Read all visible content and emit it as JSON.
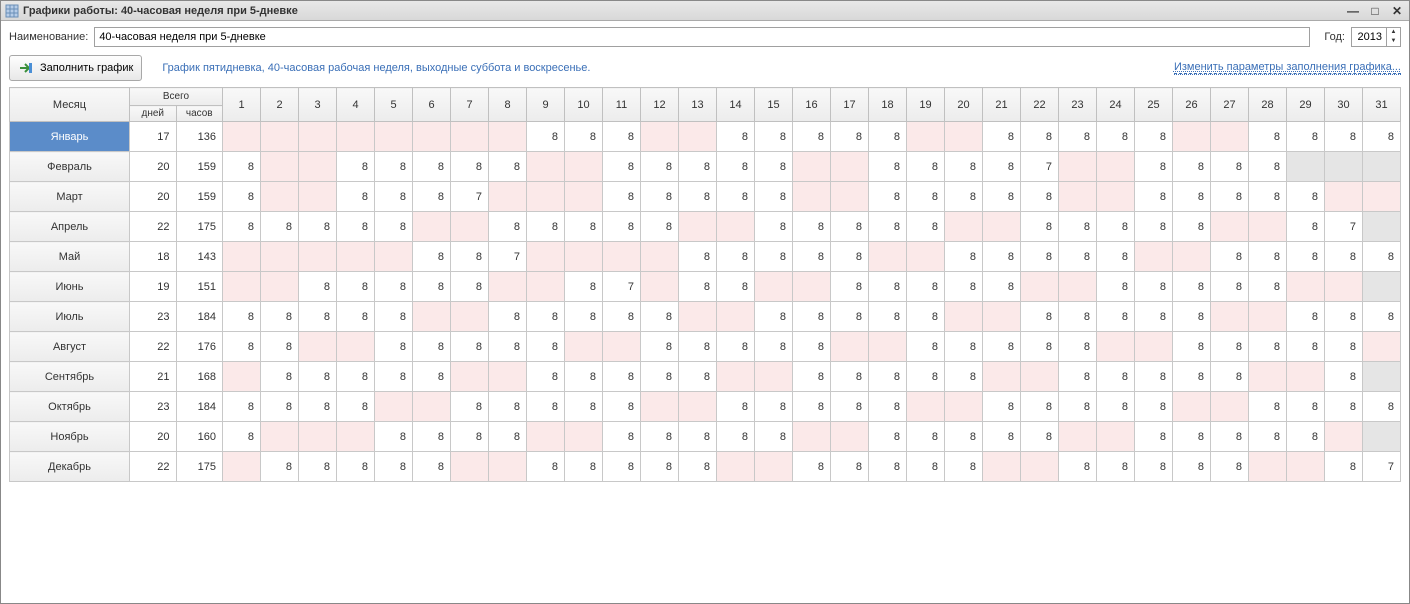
{
  "window": {
    "title": "Графики работы: 40-часовая неделя при 5-дневке"
  },
  "labels": {
    "name": "Наименование:",
    "year": "Год:",
    "fill": "Заполнить график",
    "desc": "График пятидневка, 40-часовая рабочая неделя, выходные суббота и воскресенье.",
    "change_params": "Изменить параметры заполнения графика...",
    "month": "Месяц",
    "total": "Всего",
    "days_sub": "дней",
    "hours_sub": "часов"
  },
  "values": {
    "name": "40-часовая неделя при 5-дневке",
    "year": "2013"
  },
  "day_headers": [
    "1",
    "2",
    "3",
    "4",
    "5",
    "6",
    "7",
    "8",
    "9",
    "10",
    "11",
    "12",
    "13",
    "14",
    "15",
    "16",
    "17",
    "18",
    "19",
    "20",
    "21",
    "22",
    "23",
    "24",
    "25",
    "26",
    "27",
    "28",
    "29",
    "30",
    "31"
  ],
  "months": [
    {
      "name": "Январь",
      "days": 17,
      "hours": 136,
      "selected": true,
      "cells": [
        {
          "t": "off"
        },
        {
          "t": "off"
        },
        {
          "t": "off"
        },
        {
          "t": "off"
        },
        {
          "t": "off"
        },
        {
          "t": "off"
        },
        {
          "t": "off"
        },
        {
          "t": "off"
        },
        {
          "v": 8
        },
        {
          "v": 8
        },
        {
          "v": 8
        },
        {
          "t": "off"
        },
        {
          "t": "off"
        },
        {
          "v": 8
        },
        {
          "v": 8
        },
        {
          "v": 8
        },
        {
          "v": 8
        },
        {
          "v": 8
        },
        {
          "t": "off"
        },
        {
          "t": "off"
        },
        {
          "v": 8
        },
        {
          "v": 8
        },
        {
          "v": 8
        },
        {
          "v": 8
        },
        {
          "v": 8
        },
        {
          "t": "off"
        },
        {
          "t": "off"
        },
        {
          "v": 8
        },
        {
          "v": 8
        },
        {
          "v": 8
        },
        {
          "v": 8
        }
      ]
    },
    {
      "name": "Февраль",
      "days": 20,
      "hours": 159,
      "cells": [
        {
          "v": 8
        },
        {
          "t": "off"
        },
        {
          "t": "off"
        },
        {
          "v": 8
        },
        {
          "v": 8
        },
        {
          "v": 8
        },
        {
          "v": 8
        },
        {
          "v": 8
        },
        {
          "t": "off"
        },
        {
          "t": "off"
        },
        {
          "v": 8
        },
        {
          "v": 8
        },
        {
          "v": 8
        },
        {
          "v": 8
        },
        {
          "v": 8
        },
        {
          "t": "off"
        },
        {
          "t": "off"
        },
        {
          "v": 8
        },
        {
          "v": 8
        },
        {
          "v": 8
        },
        {
          "v": 8
        },
        {
          "v": 7
        },
        {
          "t": "off"
        },
        {
          "t": "off"
        },
        {
          "v": 8
        },
        {
          "v": 8
        },
        {
          "v": 8
        },
        {
          "v": 8
        },
        {
          "t": "na"
        },
        {
          "t": "na"
        },
        {
          "t": "na"
        }
      ]
    },
    {
      "name": "Март",
      "days": 20,
      "hours": 159,
      "cells": [
        {
          "v": 8
        },
        {
          "t": "off"
        },
        {
          "t": "off"
        },
        {
          "v": 8
        },
        {
          "v": 8
        },
        {
          "v": 8
        },
        {
          "v": 7
        },
        {
          "t": "off"
        },
        {
          "t": "off"
        },
        {
          "t": "off"
        },
        {
          "v": 8
        },
        {
          "v": 8
        },
        {
          "v": 8
        },
        {
          "v": 8
        },
        {
          "v": 8
        },
        {
          "t": "off"
        },
        {
          "t": "off"
        },
        {
          "v": 8
        },
        {
          "v": 8
        },
        {
          "v": 8
        },
        {
          "v": 8
        },
        {
          "v": 8
        },
        {
          "t": "off"
        },
        {
          "t": "off"
        },
        {
          "v": 8
        },
        {
          "v": 8
        },
        {
          "v": 8
        },
        {
          "v": 8
        },
        {
          "v": 8
        },
        {
          "t": "off"
        },
        {
          "t": "off"
        }
      ]
    },
    {
      "name": "Апрель",
      "days": 22,
      "hours": 175,
      "cells": [
        {
          "v": 8
        },
        {
          "v": 8
        },
        {
          "v": 8
        },
        {
          "v": 8
        },
        {
          "v": 8
        },
        {
          "t": "off"
        },
        {
          "t": "off"
        },
        {
          "v": 8
        },
        {
          "v": 8
        },
        {
          "v": 8
        },
        {
          "v": 8
        },
        {
          "v": 8
        },
        {
          "t": "off"
        },
        {
          "t": "off"
        },
        {
          "v": 8
        },
        {
          "v": 8
        },
        {
          "v": 8
        },
        {
          "v": 8
        },
        {
          "v": 8
        },
        {
          "t": "off"
        },
        {
          "t": "off"
        },
        {
          "v": 8
        },
        {
          "v": 8
        },
        {
          "v": 8
        },
        {
          "v": 8
        },
        {
          "v": 8
        },
        {
          "t": "off"
        },
        {
          "t": "off"
        },
        {
          "v": 8
        },
        {
          "v": 7
        },
        {
          "t": "na"
        }
      ]
    },
    {
      "name": "Май",
      "days": 18,
      "hours": 143,
      "cells": [
        {
          "t": "off"
        },
        {
          "t": "off"
        },
        {
          "t": "off"
        },
        {
          "t": "off"
        },
        {
          "t": "off"
        },
        {
          "v": 8
        },
        {
          "v": 8
        },
        {
          "v": 7
        },
        {
          "t": "off"
        },
        {
          "t": "off"
        },
        {
          "t": "off"
        },
        {
          "t": "off"
        },
        {
          "v": 8
        },
        {
          "v": 8
        },
        {
          "v": 8
        },
        {
          "v": 8
        },
        {
          "v": 8
        },
        {
          "t": "off"
        },
        {
          "t": "off"
        },
        {
          "v": 8
        },
        {
          "v": 8
        },
        {
          "v": 8
        },
        {
          "v": 8
        },
        {
          "v": 8
        },
        {
          "t": "off"
        },
        {
          "t": "off"
        },
        {
          "v": 8
        },
        {
          "v": 8
        },
        {
          "v": 8
        },
        {
          "v": 8
        },
        {
          "v": 8
        }
      ]
    },
    {
      "name": "Июнь",
      "days": 19,
      "hours": 151,
      "cells": [
        {
          "t": "off"
        },
        {
          "t": "off"
        },
        {
          "v": 8
        },
        {
          "v": 8
        },
        {
          "v": 8
        },
        {
          "v": 8
        },
        {
          "v": 8
        },
        {
          "t": "off"
        },
        {
          "t": "off"
        },
        {
          "v": 8
        },
        {
          "v": 7
        },
        {
          "t": "off"
        },
        {
          "v": 8
        },
        {
          "v": 8
        },
        {
          "t": "off"
        },
        {
          "t": "off"
        },
        {
          "v": 8
        },
        {
          "v": 8
        },
        {
          "v": 8
        },
        {
          "v": 8
        },
        {
          "v": 8
        },
        {
          "t": "off"
        },
        {
          "t": "off"
        },
        {
          "v": 8
        },
        {
          "v": 8
        },
        {
          "v": 8
        },
        {
          "v": 8
        },
        {
          "v": 8
        },
        {
          "t": "off"
        },
        {
          "t": "off"
        },
        {
          "t": "na"
        }
      ]
    },
    {
      "name": "Июль",
      "days": 23,
      "hours": 184,
      "cells": [
        {
          "v": 8
        },
        {
          "v": 8
        },
        {
          "v": 8
        },
        {
          "v": 8
        },
        {
          "v": 8
        },
        {
          "t": "off"
        },
        {
          "t": "off"
        },
        {
          "v": 8
        },
        {
          "v": 8
        },
        {
          "v": 8
        },
        {
          "v": 8
        },
        {
          "v": 8
        },
        {
          "t": "off"
        },
        {
          "t": "off"
        },
        {
          "v": 8
        },
        {
          "v": 8
        },
        {
          "v": 8
        },
        {
          "v": 8
        },
        {
          "v": 8
        },
        {
          "t": "off"
        },
        {
          "t": "off"
        },
        {
          "v": 8
        },
        {
          "v": 8
        },
        {
          "v": 8
        },
        {
          "v": 8
        },
        {
          "v": 8
        },
        {
          "t": "off"
        },
        {
          "t": "off"
        },
        {
          "v": 8
        },
        {
          "v": 8
        },
        {
          "v": 8
        }
      ]
    },
    {
      "name": "Август",
      "days": 22,
      "hours": 176,
      "cells": [
        {
          "v": 8
        },
        {
          "v": 8
        },
        {
          "t": "off"
        },
        {
          "t": "off"
        },
        {
          "v": 8
        },
        {
          "v": 8
        },
        {
          "v": 8
        },
        {
          "v": 8
        },
        {
          "v": 8
        },
        {
          "t": "off"
        },
        {
          "t": "off"
        },
        {
          "v": 8
        },
        {
          "v": 8
        },
        {
          "v": 8
        },
        {
          "v": 8
        },
        {
          "v": 8
        },
        {
          "t": "off"
        },
        {
          "t": "off"
        },
        {
          "v": 8
        },
        {
          "v": 8
        },
        {
          "v": 8
        },
        {
          "v": 8
        },
        {
          "v": 8
        },
        {
          "t": "off"
        },
        {
          "t": "off"
        },
        {
          "v": 8
        },
        {
          "v": 8
        },
        {
          "v": 8
        },
        {
          "v": 8
        },
        {
          "v": 8
        },
        {
          "t": "off"
        }
      ]
    },
    {
      "name": "Сентябрь",
      "days": 21,
      "hours": 168,
      "cells": [
        {
          "t": "off"
        },
        {
          "v": 8
        },
        {
          "v": 8
        },
        {
          "v": 8
        },
        {
          "v": 8
        },
        {
          "v": 8
        },
        {
          "t": "off"
        },
        {
          "t": "off"
        },
        {
          "v": 8
        },
        {
          "v": 8
        },
        {
          "v": 8
        },
        {
          "v": 8
        },
        {
          "v": 8
        },
        {
          "t": "off"
        },
        {
          "t": "off"
        },
        {
          "v": 8
        },
        {
          "v": 8
        },
        {
          "v": 8
        },
        {
          "v": 8
        },
        {
          "v": 8
        },
        {
          "t": "off"
        },
        {
          "t": "off"
        },
        {
          "v": 8
        },
        {
          "v": 8
        },
        {
          "v": 8
        },
        {
          "v": 8
        },
        {
          "v": 8
        },
        {
          "t": "off"
        },
        {
          "t": "off"
        },
        {
          "v": 8
        },
        {
          "t": "na"
        }
      ]
    },
    {
      "name": "Октябрь",
      "days": 23,
      "hours": 184,
      "cells": [
        {
          "v": 8
        },
        {
          "v": 8
        },
        {
          "v": 8
        },
        {
          "v": 8
        },
        {
          "t": "off"
        },
        {
          "t": "off"
        },
        {
          "v": 8
        },
        {
          "v": 8
        },
        {
          "v": 8
        },
        {
          "v": 8
        },
        {
          "v": 8
        },
        {
          "t": "off"
        },
        {
          "t": "off"
        },
        {
          "v": 8
        },
        {
          "v": 8
        },
        {
          "v": 8
        },
        {
          "v": 8
        },
        {
          "v": 8
        },
        {
          "t": "off"
        },
        {
          "t": "off"
        },
        {
          "v": 8
        },
        {
          "v": 8
        },
        {
          "v": 8
        },
        {
          "v": 8
        },
        {
          "v": 8
        },
        {
          "t": "off"
        },
        {
          "t": "off"
        },
        {
          "v": 8
        },
        {
          "v": 8
        },
        {
          "v": 8
        },
        {
          "v": 8
        }
      ]
    },
    {
      "name": "Ноябрь",
      "days": 20,
      "hours": 160,
      "cells": [
        {
          "v": 8
        },
        {
          "t": "off"
        },
        {
          "t": "off"
        },
        {
          "t": "off"
        },
        {
          "v": 8
        },
        {
          "v": 8
        },
        {
          "v": 8
        },
        {
          "v": 8
        },
        {
          "t": "off"
        },
        {
          "t": "off"
        },
        {
          "v": 8
        },
        {
          "v": 8
        },
        {
          "v": 8
        },
        {
          "v": 8
        },
        {
          "v": 8
        },
        {
          "t": "off"
        },
        {
          "t": "off"
        },
        {
          "v": 8
        },
        {
          "v": 8
        },
        {
          "v": 8
        },
        {
          "v": 8
        },
        {
          "v": 8
        },
        {
          "t": "off"
        },
        {
          "t": "off"
        },
        {
          "v": 8
        },
        {
          "v": 8
        },
        {
          "v": 8
        },
        {
          "v": 8
        },
        {
          "v": 8
        },
        {
          "t": "off"
        },
        {
          "t": "na"
        }
      ]
    },
    {
      "name": "Декабрь",
      "days": 22,
      "hours": 175,
      "cells": [
        {
          "t": "off"
        },
        {
          "v": 8
        },
        {
          "v": 8
        },
        {
          "v": 8
        },
        {
          "v": 8
        },
        {
          "v": 8
        },
        {
          "t": "off"
        },
        {
          "t": "off"
        },
        {
          "v": 8
        },
        {
          "v": 8
        },
        {
          "v": 8
        },
        {
          "v": 8
        },
        {
          "v": 8
        },
        {
          "t": "off"
        },
        {
          "t": "off"
        },
        {
          "v": 8
        },
        {
          "v": 8
        },
        {
          "v": 8
        },
        {
          "v": 8
        },
        {
          "v": 8
        },
        {
          "t": "off"
        },
        {
          "t": "off"
        },
        {
          "v": 8
        },
        {
          "v": 8
        },
        {
          "v": 8
        },
        {
          "v": 8
        },
        {
          "v": 8
        },
        {
          "t": "off"
        },
        {
          "t": "off"
        },
        {
          "v": 8
        },
        {
          "v": 7
        }
      ]
    }
  ]
}
